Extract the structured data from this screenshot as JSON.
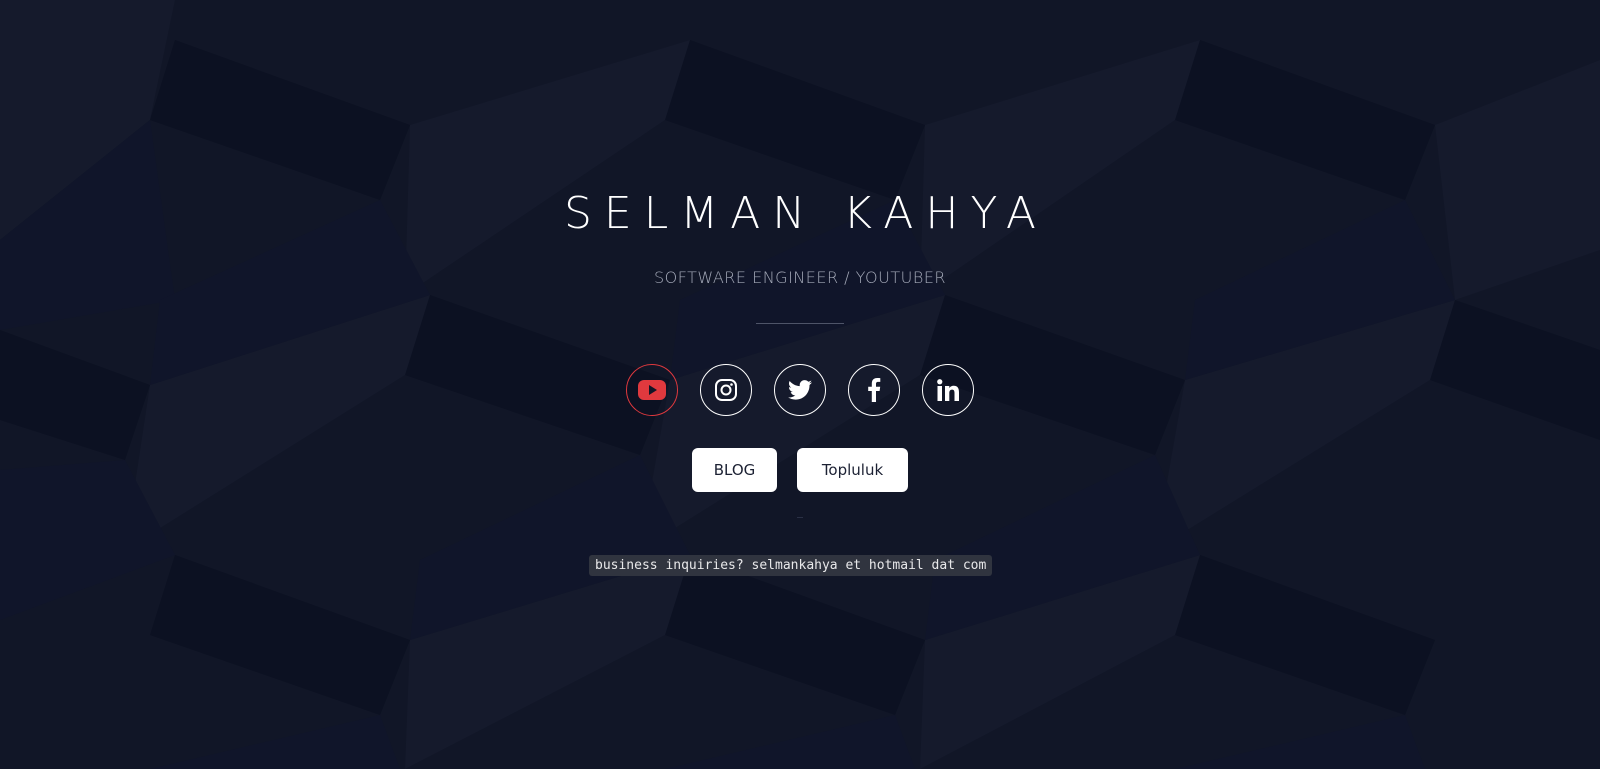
{
  "header": {
    "name": "SELMAN KAHYA",
    "subtitle": "SOFTWARE ENGINEER / YOUTUBER"
  },
  "socials": [
    {
      "icon": "youtube-icon",
      "active": true
    },
    {
      "icon": "instagram-icon",
      "active": false
    },
    {
      "icon": "twitter-icon",
      "active": false
    },
    {
      "icon": "facebook-icon",
      "active": false
    },
    {
      "icon": "linkedin-icon",
      "active": false
    }
  ],
  "buttons": {
    "blog_label": "BLOG",
    "community_label": "Topluluk"
  },
  "footer": {
    "inquiry": "business inquiries? selmankahya et hotmail dat com"
  },
  "colors": {
    "background": "#111627",
    "accent_red": "#e0393e",
    "text": "#ffffff",
    "muted": "#a4a9b8"
  }
}
